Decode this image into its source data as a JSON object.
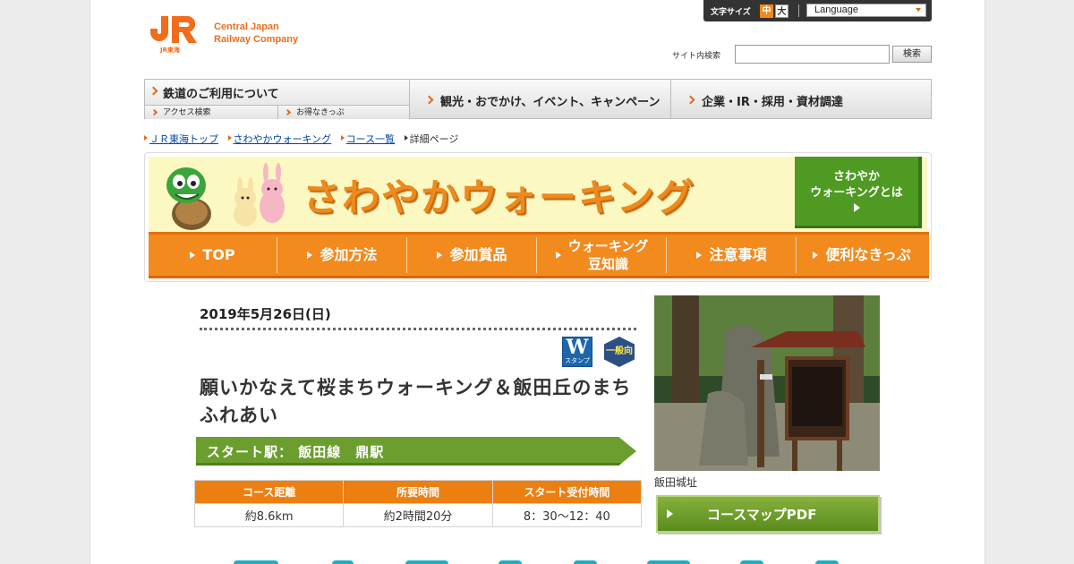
{
  "header": {
    "font_size_label": "文字サイズ",
    "font_size_medium": "中",
    "font_size_large": "大",
    "language": "Language",
    "logo_line1": "Central Japan",
    "logo_line2": "Railway Company",
    "logo_sub": "JR東海",
    "search_label": "サイト内検索",
    "search_placeholder": "",
    "search_button": "検索"
  },
  "global_nav": {
    "items": [
      {
        "label": "鉄道のご利用について",
        "subs": [
          "アクセス検索",
          "お得なきっぷ"
        ]
      },
      {
        "label": "観光・おでかけ、イベント、キャンペーン"
      },
      {
        "label": "企業・IR・採用・資材調達"
      }
    ]
  },
  "breadcrumb": [
    "ＪＲ東海トップ",
    "さわやかウォーキング",
    "コース一覧",
    "詳細ページ"
  ],
  "banner": {
    "title": "さわやかウォーキング",
    "about_line1": "さわやか",
    "about_line2": "ウォーキングとは"
  },
  "walking_nav": [
    {
      "label": "TOP"
    },
    {
      "label": "参加方法"
    },
    {
      "label": "参加賞品"
    },
    {
      "label": "ウォーキング 豆知識"
    },
    {
      "label": "注意事項"
    },
    {
      "label": "便利なきっぷ"
    }
  ],
  "course": {
    "date": "2019年5月26日(日)",
    "badge_w_big": "W",
    "badge_w_small": "スタンプ",
    "badge_general": "一般向",
    "title": "願いかなえて桜まちウォーキング＆飯田丘のまちふれあい",
    "station": "スタート駅：  飯田線　鼎駅",
    "table_headers": [
      "コース距離",
      "所要時間",
      "スタート受付時間"
    ],
    "table_values": [
      "約8.6km",
      "約2時間20分",
      "8：30～12：40"
    ],
    "photo_caption": "飯田城址",
    "pdf_button": "コースマップPDF"
  },
  "colors": {
    "orange": "#f28a1e",
    "green": "#6b9d2f",
    "jr_orange": "#f06d1c"
  }
}
